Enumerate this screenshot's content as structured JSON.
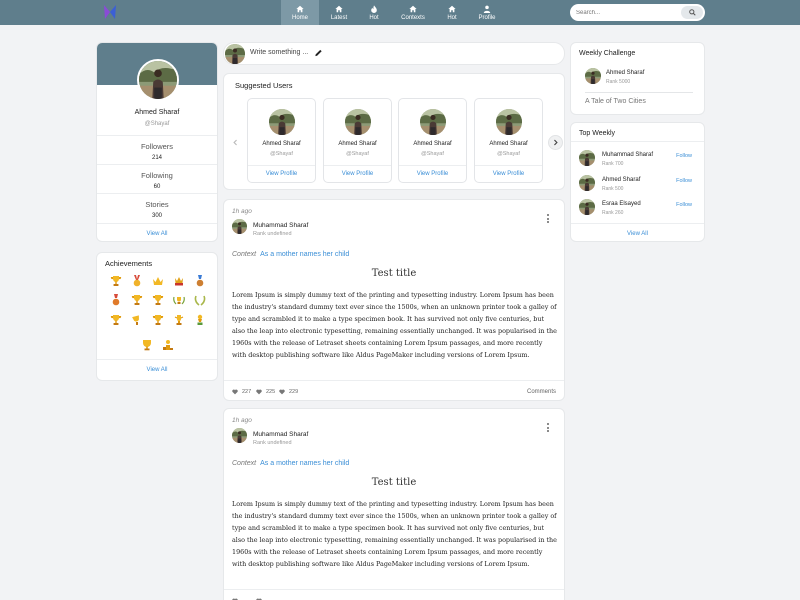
{
  "colors": {
    "nav_bg": "#5f7e8c",
    "accent": "#3a8ed6",
    "page_bg": "#f2f3f5"
  },
  "nav": {
    "items": [
      {
        "label": "Home",
        "icon": "home-icon",
        "active": true
      },
      {
        "label": "Latest",
        "icon": "home-icon"
      },
      {
        "label": "Hot",
        "icon": "fire-icon"
      },
      {
        "label": "Contexts",
        "icon": "home-icon"
      },
      {
        "label": "Hot",
        "icon": "home-icon"
      },
      {
        "label": "Profile",
        "icon": "user-icon"
      }
    ],
    "search_placeholder": "Search...",
    "search_icon": "search-icon"
  },
  "profile": {
    "name": "Ahmed Sharaf",
    "handle": "@Shayaf",
    "stats": [
      {
        "label": "Followers",
        "value": "214"
      },
      {
        "label": "Following",
        "value": "60"
      },
      {
        "label": "Stories",
        "value": "300"
      }
    ],
    "view_all": "View All"
  },
  "achievements": {
    "title": "Achievements",
    "view_all": "View All",
    "icons": [
      "trophy-icon",
      "medal-icon",
      "crown-icon",
      "champion-icon",
      "bronze-medal-icon",
      "medal-icon",
      "trophy-icon",
      "laurel-trophy-icon",
      "laurel-icon",
      "trophy-icon",
      "trophy-icon",
      "trophy-icon",
      "trophy-icon",
      "trophy-icon",
      "trophy-icon",
      "podium-icon"
    ]
  },
  "write": {
    "placeholder": "Write something ...",
    "icon": "pen-icon"
  },
  "suggested": {
    "title": "Suggested Users",
    "users": [
      {
        "name": "Ahmed Sharaf",
        "handle": "@Shayaf",
        "action": "View Profile"
      },
      {
        "name": "Ahmed Sharaf",
        "handle": "@Shayaf",
        "action": "View Profile"
      },
      {
        "name": "Ahmed Sharaf",
        "handle": "@Shayaf",
        "action": "View Profile"
      },
      {
        "name": "Ahmed Sharaf",
        "handle": "@Shayaf",
        "action": "View Profile"
      }
    ]
  },
  "posts": [
    {
      "time": "1h ago",
      "author": "Muhammad Sharaf",
      "rank": "Rank undefined",
      "context_label": "Context",
      "context_value": "As a mother names her child",
      "title": "Test title",
      "body": "Lorem Ipsum is simply dummy text of the printing and typesetting industry. Lorem Ipsum has been the industry's standard dummy text ever since the 1500s, when an unknown printer took a galley of type and scrambled it to make a type specimen book. It has survived not only five centuries, but also the leap into electronic typesetting, remaining essentially unchanged. It was popularised in the 1960s with the release of Letraset sheets containing Lorem Ipsum passages, and more recently with desktop publishing software like Aldus PageMaker including versions of Lorem Ipsum.",
      "reactions": [
        "227",
        "225",
        "229"
      ],
      "comments": "Comments"
    },
    {
      "time": "1h ago",
      "author": "Muhammad Sharaf",
      "rank": "Rank undefined",
      "context_label": "Context",
      "context_value": "As a mother names her child",
      "title": "Test title",
      "body": "Lorem Ipsum is simply dummy text of the printing and typesetting industry. Lorem Ipsum has been the industry's standard dummy text ever since the 1500s, when an unknown printer took a galley of type and scrambled it to make a type specimen book. It has survived not only five centuries, but also the leap into electronic typesetting, remaining essentially unchanged. It was popularised in the 1960s with the release of Letraset sheets containing Lorem Ipsum passages, and more recently with desktop publishing software like Aldus PageMaker including versions of Lorem Ipsum.",
      "reactions": [
        "",
        "",
        ""
      ],
      "comments": ""
    }
  ],
  "weekly": {
    "title": "Weekly Challenge",
    "name": "Ahmed Sharaf",
    "rank": "Rank 5000",
    "story": "A Tale of Two Cities"
  },
  "top_weekly": {
    "title": "Top Weekly",
    "users": [
      {
        "name": "Muhammad Sharaf",
        "rank": "Rank 700",
        "action": "Follow"
      },
      {
        "name": "Ahmed Sharaf",
        "rank": "Rank 500",
        "action": "Follow"
      },
      {
        "name": "Esraa Elsayed",
        "rank": "Rank 260",
        "action": "Follow"
      }
    ],
    "view_all": "View All"
  }
}
